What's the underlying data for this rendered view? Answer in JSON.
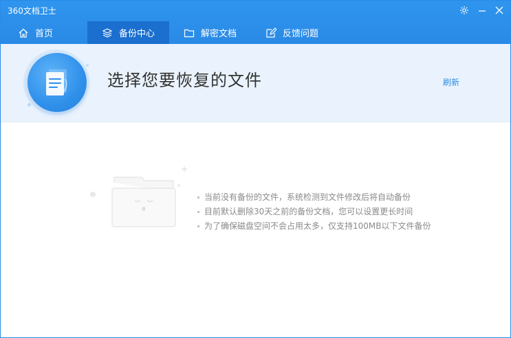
{
  "window": {
    "title": "360文档卫士",
    "controls": [
      "gear-icon",
      "minimize-icon",
      "close-icon"
    ]
  },
  "nav": {
    "tabs": [
      {
        "label": "首页",
        "icon": "home-icon"
      },
      {
        "label": "备份中心",
        "icon": "layers-icon",
        "active": true
      },
      {
        "label": "解密文档",
        "icon": "folder-icon"
      },
      {
        "label": "反馈问题",
        "icon": "edit-icon"
      }
    ]
  },
  "header": {
    "title": "选择您要恢复的文件",
    "refresh_label": "刷新"
  },
  "empty_state": {
    "illustration": "empty-folder-icon",
    "tips": [
      "当前没有备份的文件，系统检测到文件修改后将自动备份",
      "目前默认删除30天之前的备份文档，您可以设置更长时间",
      "为了确保磁盘空间不会占用太多，仅支持100MB以下文件备份"
    ]
  },
  "colors": {
    "accent": "#2a8ae6",
    "active_tab": "#1a6fcf",
    "header_bg": "#eaf3fd",
    "link": "#2d8de6",
    "tip_text": "#8a8a8a"
  }
}
